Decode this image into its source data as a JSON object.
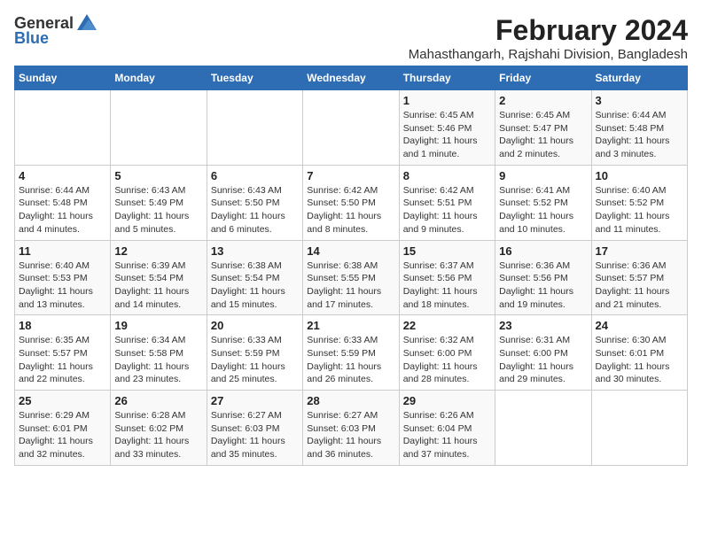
{
  "logo": {
    "general": "General",
    "blue": "Blue"
  },
  "title": "February 2024",
  "subtitle": "Mahasthangarh, Rajshahi Division, Bangladesh",
  "days_of_week": [
    "Sunday",
    "Monday",
    "Tuesday",
    "Wednesday",
    "Thursday",
    "Friday",
    "Saturday"
  ],
  "weeks": [
    [
      {
        "day": "",
        "detail": ""
      },
      {
        "day": "",
        "detail": ""
      },
      {
        "day": "",
        "detail": ""
      },
      {
        "day": "",
        "detail": ""
      },
      {
        "day": "1",
        "detail": "Sunrise: 6:45 AM\nSunset: 5:46 PM\nDaylight: 11 hours\nand 1 minute."
      },
      {
        "day": "2",
        "detail": "Sunrise: 6:45 AM\nSunset: 5:47 PM\nDaylight: 11 hours\nand 2 minutes."
      },
      {
        "day": "3",
        "detail": "Sunrise: 6:44 AM\nSunset: 5:48 PM\nDaylight: 11 hours\nand 3 minutes."
      }
    ],
    [
      {
        "day": "4",
        "detail": "Sunrise: 6:44 AM\nSunset: 5:48 PM\nDaylight: 11 hours\nand 4 minutes."
      },
      {
        "day": "5",
        "detail": "Sunrise: 6:43 AM\nSunset: 5:49 PM\nDaylight: 11 hours\nand 5 minutes."
      },
      {
        "day": "6",
        "detail": "Sunrise: 6:43 AM\nSunset: 5:50 PM\nDaylight: 11 hours\nand 6 minutes."
      },
      {
        "day": "7",
        "detail": "Sunrise: 6:42 AM\nSunset: 5:50 PM\nDaylight: 11 hours\nand 8 minutes."
      },
      {
        "day": "8",
        "detail": "Sunrise: 6:42 AM\nSunset: 5:51 PM\nDaylight: 11 hours\nand 9 minutes."
      },
      {
        "day": "9",
        "detail": "Sunrise: 6:41 AM\nSunset: 5:52 PM\nDaylight: 11 hours\nand 10 minutes."
      },
      {
        "day": "10",
        "detail": "Sunrise: 6:40 AM\nSunset: 5:52 PM\nDaylight: 11 hours\nand 11 minutes."
      }
    ],
    [
      {
        "day": "11",
        "detail": "Sunrise: 6:40 AM\nSunset: 5:53 PM\nDaylight: 11 hours\nand 13 minutes."
      },
      {
        "day": "12",
        "detail": "Sunrise: 6:39 AM\nSunset: 5:54 PM\nDaylight: 11 hours\nand 14 minutes."
      },
      {
        "day": "13",
        "detail": "Sunrise: 6:38 AM\nSunset: 5:54 PM\nDaylight: 11 hours\nand 15 minutes."
      },
      {
        "day": "14",
        "detail": "Sunrise: 6:38 AM\nSunset: 5:55 PM\nDaylight: 11 hours\nand 17 minutes."
      },
      {
        "day": "15",
        "detail": "Sunrise: 6:37 AM\nSunset: 5:56 PM\nDaylight: 11 hours\nand 18 minutes."
      },
      {
        "day": "16",
        "detail": "Sunrise: 6:36 AM\nSunset: 5:56 PM\nDaylight: 11 hours\nand 19 minutes."
      },
      {
        "day": "17",
        "detail": "Sunrise: 6:36 AM\nSunset: 5:57 PM\nDaylight: 11 hours\nand 21 minutes."
      }
    ],
    [
      {
        "day": "18",
        "detail": "Sunrise: 6:35 AM\nSunset: 5:57 PM\nDaylight: 11 hours\nand 22 minutes."
      },
      {
        "day": "19",
        "detail": "Sunrise: 6:34 AM\nSunset: 5:58 PM\nDaylight: 11 hours\nand 23 minutes."
      },
      {
        "day": "20",
        "detail": "Sunrise: 6:33 AM\nSunset: 5:59 PM\nDaylight: 11 hours\nand 25 minutes."
      },
      {
        "day": "21",
        "detail": "Sunrise: 6:33 AM\nSunset: 5:59 PM\nDaylight: 11 hours\nand 26 minutes."
      },
      {
        "day": "22",
        "detail": "Sunrise: 6:32 AM\nSunset: 6:00 PM\nDaylight: 11 hours\nand 28 minutes."
      },
      {
        "day": "23",
        "detail": "Sunrise: 6:31 AM\nSunset: 6:00 PM\nDaylight: 11 hours\nand 29 minutes."
      },
      {
        "day": "24",
        "detail": "Sunrise: 6:30 AM\nSunset: 6:01 PM\nDaylight: 11 hours\nand 30 minutes."
      }
    ],
    [
      {
        "day": "25",
        "detail": "Sunrise: 6:29 AM\nSunset: 6:01 PM\nDaylight: 11 hours\nand 32 minutes."
      },
      {
        "day": "26",
        "detail": "Sunrise: 6:28 AM\nSunset: 6:02 PM\nDaylight: 11 hours\nand 33 minutes."
      },
      {
        "day": "27",
        "detail": "Sunrise: 6:27 AM\nSunset: 6:03 PM\nDaylight: 11 hours\nand 35 minutes."
      },
      {
        "day": "28",
        "detail": "Sunrise: 6:27 AM\nSunset: 6:03 PM\nDaylight: 11 hours\nand 36 minutes."
      },
      {
        "day": "29",
        "detail": "Sunrise: 6:26 AM\nSunset: 6:04 PM\nDaylight: 11 hours\nand 37 minutes."
      },
      {
        "day": "",
        "detail": ""
      },
      {
        "day": "",
        "detail": ""
      }
    ]
  ]
}
